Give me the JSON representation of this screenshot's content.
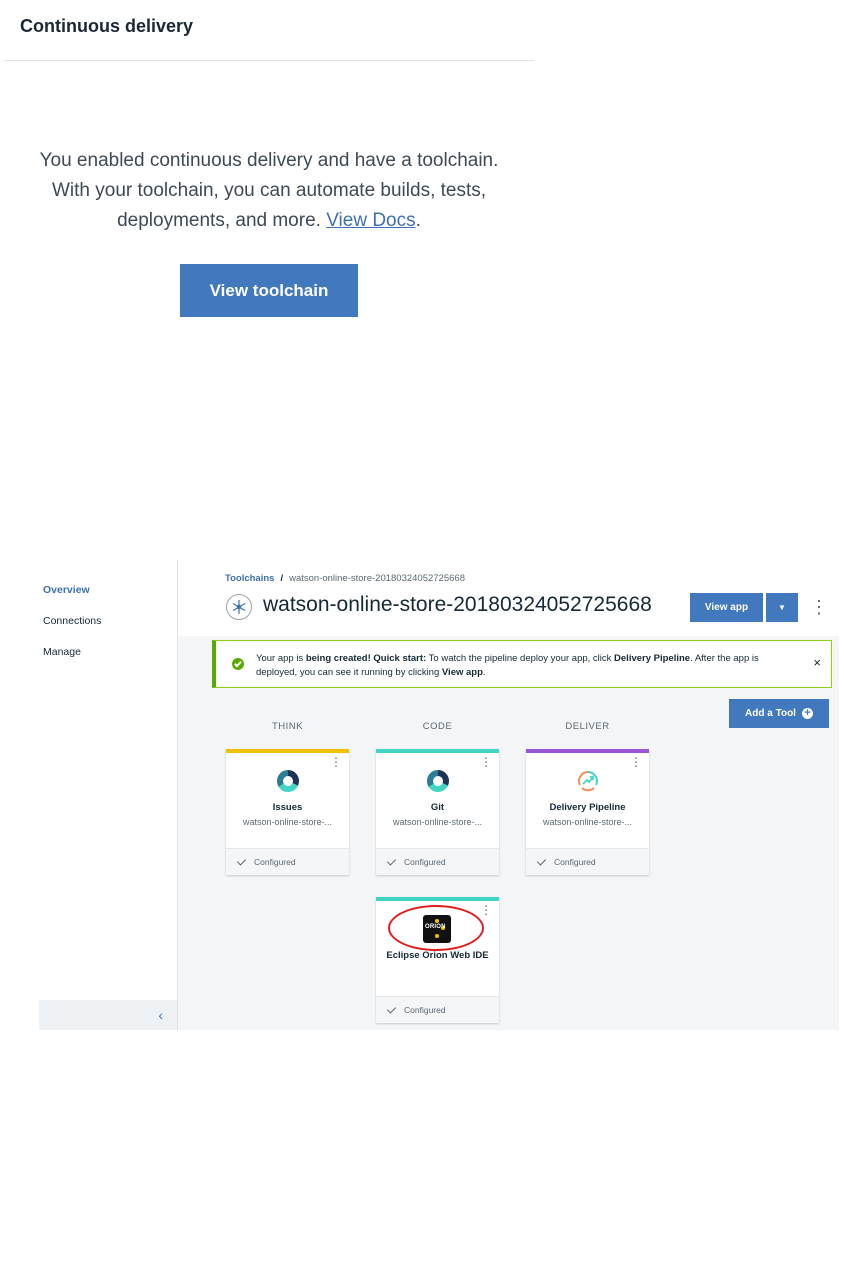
{
  "top_panel": {
    "title": "Continuous delivery",
    "message_pre": "You enabled continuous delivery and have a toolchain. With your toolchain, you can automate builds, tests, deployments, and more. ",
    "docs_link": "View Docs",
    "message_post": ".",
    "button_label": "View toolchain",
    "accent_color": "#4178be"
  },
  "toolchain": {
    "sidebar": {
      "items": [
        {
          "label": "Overview",
          "active": true
        },
        {
          "label": "Connections",
          "active": false
        },
        {
          "label": "Manage",
          "active": false
        }
      ],
      "collapse_icon": "chevron-left-icon"
    },
    "breadcrumb": {
      "root": "Toolchains",
      "separator": "/",
      "current": "watson-online-store-20180324052725668"
    },
    "title": "watson-online-store-20180324052725668",
    "view_app_label": "View app",
    "notification": {
      "part1": "Your app is ",
      "bold1": "being created!",
      "part2": " ",
      "bold2": "Quick start:",
      "part3": " To watch the pipeline deploy your app, click ",
      "bold3": "Delivery Pipeline",
      "part4": ". After the app is deployed, you can see it running by clicking ",
      "bold4": "View app",
      "part5": ".",
      "close": "×"
    },
    "add_tool_label": "Add a Tool",
    "phases": [
      "THINK",
      "CODE",
      "DELIVER"
    ],
    "cards": [
      {
        "name": "Issues",
        "subtitle": "watson-online-store-...",
        "status": "Configured",
        "bar_color": "#efc100",
        "icon": "issues-icon"
      },
      {
        "name": "Git",
        "subtitle": "watson-online-store-...",
        "status": "Configured",
        "bar_color": "#41d6c3",
        "icon": "git-icon"
      },
      {
        "name": "Delivery Pipeline",
        "subtitle": "watson-online-store-...",
        "status": "Configured",
        "bar_color": "#9855d4",
        "icon": "pipeline-icon"
      },
      {
        "name": "Eclipse Orion Web IDE",
        "subtitle": "",
        "status": "Configured",
        "bar_color": "#41d6c3",
        "icon": "orion-icon",
        "logo_text": "ORION"
      }
    ]
  }
}
